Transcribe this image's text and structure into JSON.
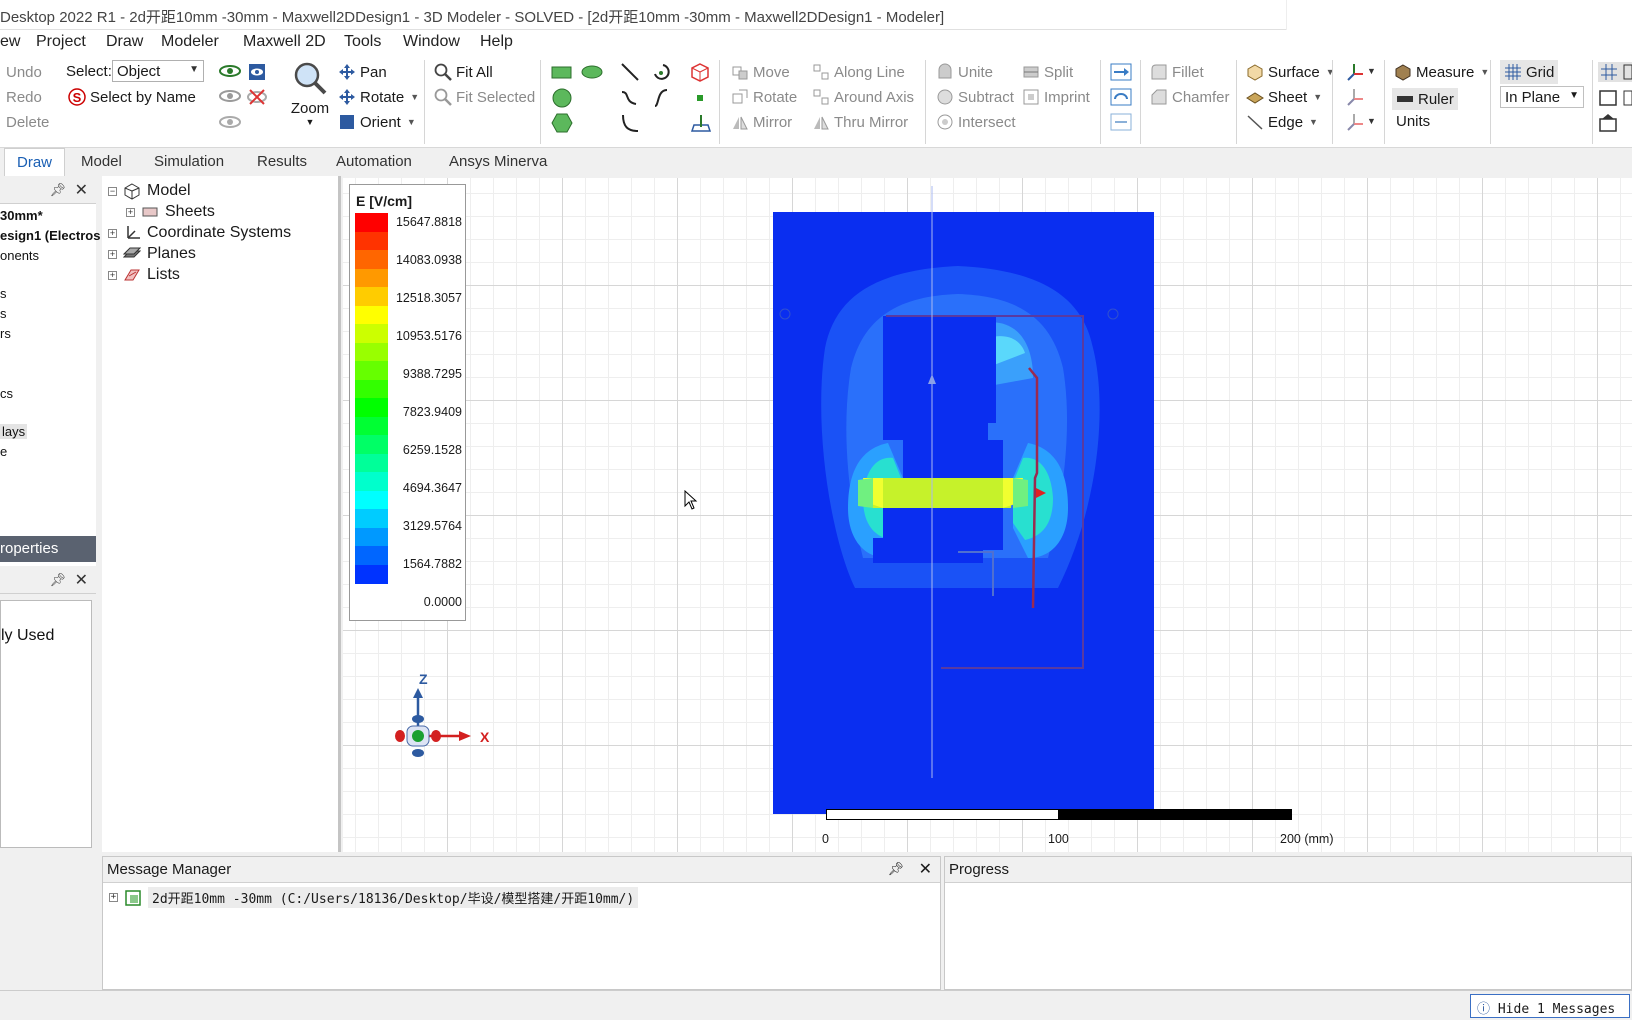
{
  "window": {
    "title": "Desktop 2022 R1 - 2d开距10mm -30mm - Maxwell2DDesign1 - 3D Modeler - SOLVED - [2d开距10mm -30mm - Maxwell2DDesign1 - Modeler]"
  },
  "menu": [
    "ew",
    "Project",
    "Draw",
    "Modeler",
    "Maxwell 2D",
    "Tools",
    "Window",
    "Help"
  ],
  "ribbon": {
    "undo": "Undo",
    "redo": "Redo",
    "delete": "Delete",
    "select_label": "Select:",
    "select_value": "Object",
    "select_by_name": "Select by Name",
    "zoom": "Zoom",
    "pan": "Pan",
    "rotate": "Rotate",
    "orient": "Orient",
    "fit_all": "Fit All",
    "fit_selected": "Fit Selected",
    "move": "Move",
    "rotate_op": "Rotate",
    "mirror": "Mirror",
    "along_line": "Along Line",
    "around_axis": "Around Axis",
    "thru_mirror": "Thru Mirror",
    "unite": "Unite",
    "subtract": "Subtract",
    "intersect": "Intersect",
    "split": "Split",
    "imprint": "Imprint",
    "fillet": "Fillet",
    "chamfer": "Chamfer",
    "surface": "Surface",
    "sheet": "Sheet",
    "edge": "Edge",
    "measure": "Measure",
    "ruler": "Ruler",
    "units": "Units",
    "grid": "Grid",
    "in_plane": "In Plane"
  },
  "tabs": [
    "Draw",
    "Model",
    "Simulation",
    "Results",
    "Automation",
    "Ansys Minerva"
  ],
  "left_panel": {
    "lines": [
      "30mm*",
      "esign1 (Electros",
      "onents",
      "s",
      "s",
      "rs",
      "cs",
      "lays",
      "e"
    ],
    "properties_title": "roperties",
    "recently_used": "ly Used"
  },
  "tree": {
    "model": "Model",
    "sheets": "Sheets",
    "coordinate_systems": "Coordinate Systems",
    "planes": "Planes",
    "lists": "Lists"
  },
  "legend": {
    "title": "E [V/cm]",
    "values": [
      "15647.8818",
      "14083.0938",
      "12518.3057",
      "10953.5176",
      "9388.7295",
      "7823.9409",
      "6259.1528",
      "4694.3647",
      "3129.5764",
      "1564.7882",
      "0.0000"
    ],
    "colors": [
      "#ff0000",
      "#ff3300",
      "#ff6600",
      "#ff9900",
      "#ffcc00",
      "#ffff00",
      "#ccff00",
      "#99ff00",
      "#66ff00",
      "#33ff00",
      "#00ff00",
      "#00ff33",
      "#00ff66",
      "#00ff99",
      "#00ffcc",
      "#00ffff",
      "#00ccff",
      "#0099ff",
      "#0066ff",
      "#0033ff"
    ]
  },
  "axes": {
    "z": "Z",
    "x": "X"
  },
  "scale": {
    "labels": [
      "0",
      "100",
      "200 (mm)"
    ]
  },
  "message_manager": {
    "title": "Message Manager",
    "entry": "2d开距10mm -30mm (C:/Users/18136/Desktop/毕设/模型搭建/开距10mm/)"
  },
  "progress": {
    "title": "Progress"
  },
  "status": {
    "hide_messages": "Hide 1 Messages"
  }
}
